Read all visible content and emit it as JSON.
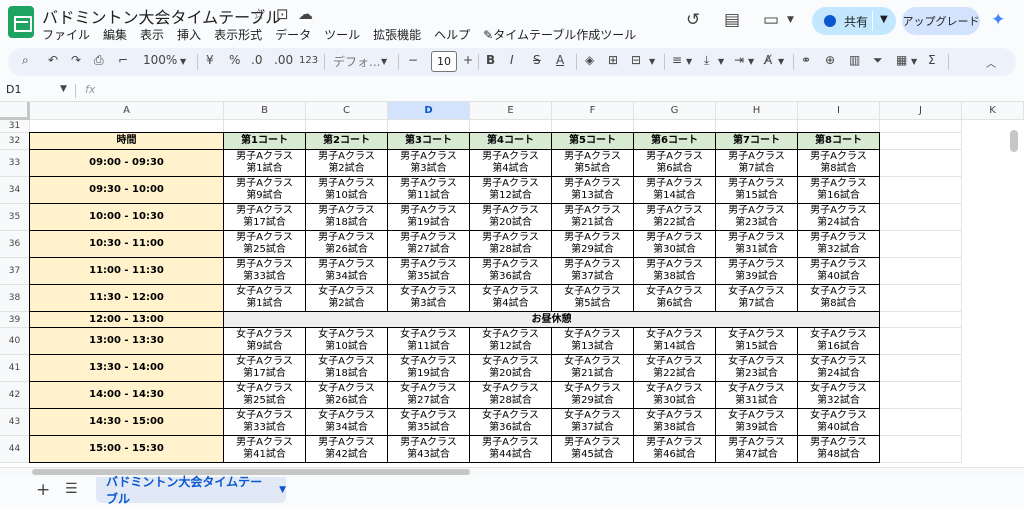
{
  "header": {
    "title": "バドミントン大会タイムテーブル",
    "menu": [
      "ファイル",
      "編集",
      "表示",
      "挿入",
      "表示形式",
      "データ",
      "ツール",
      "拡張機能",
      "ヘルプ",
      "タイムテーブル作成ツール"
    ],
    "share_label": "共有",
    "upgrade_label": "アップグレード"
  },
  "toolbar": {
    "zoom": "100%",
    "currency": "¥",
    "percent": "%",
    "dec_decrease": ".0",
    "dec_increase": ".00",
    "number_format": "123",
    "font": "デフォ...",
    "font_size": "10"
  },
  "formula_bar": {
    "cell_ref": "D1",
    "fx": "fx"
  },
  "columns": [
    "A",
    "B",
    "C",
    "D",
    "E",
    "F",
    "G",
    "H",
    "I",
    "J",
    "K"
  ],
  "selected_column": "D",
  "rows": [
    "31",
    "32",
    "33",
    "34",
    "35",
    "36",
    "37",
    "38",
    "39",
    "40",
    "41",
    "42",
    "43",
    "44"
  ],
  "table": {
    "time_header": "時間",
    "courts": [
      "第1コート",
      "第2コート",
      "第3コート",
      "第4コート",
      "第5コート",
      "第6コート",
      "第7コート",
      "第8コート"
    ],
    "break_label": "お昼休憩",
    "slots": [
      {
        "time": "09:00 - 09:30",
        "cells": [
          [
            "男子Aクラス",
            "第1試合"
          ],
          [
            "男子Aクラス",
            "第2試合"
          ],
          [
            "男子Aクラス",
            "第3試合"
          ],
          [
            "男子Aクラス",
            "第4試合"
          ],
          [
            "男子Aクラス",
            "第5試合"
          ],
          [
            "男子Aクラス",
            "第6試合"
          ],
          [
            "男子Aクラス",
            "第7試合"
          ],
          [
            "男子Aクラス",
            "第8試合"
          ]
        ]
      },
      {
        "time": "09:30 - 10:00",
        "cells": [
          [
            "男子Aクラス",
            "第9試合"
          ],
          [
            "男子Aクラス",
            "第10試合"
          ],
          [
            "男子Aクラス",
            "第11試合"
          ],
          [
            "男子Aクラス",
            "第12試合"
          ],
          [
            "男子Aクラス",
            "第13試合"
          ],
          [
            "男子Aクラス",
            "第14試合"
          ],
          [
            "男子Aクラス",
            "第15試合"
          ],
          [
            "男子Aクラス",
            "第16試合"
          ]
        ]
      },
      {
        "time": "10:00 - 10:30",
        "cells": [
          [
            "男子Aクラス",
            "第17試合"
          ],
          [
            "男子Aクラス",
            "第18試合"
          ],
          [
            "男子Aクラス",
            "第19試合"
          ],
          [
            "男子Aクラス",
            "第20試合"
          ],
          [
            "男子Aクラス",
            "第21試合"
          ],
          [
            "男子Aクラス",
            "第22試合"
          ],
          [
            "男子Aクラス",
            "第23試合"
          ],
          [
            "男子Aクラス",
            "第24試合"
          ]
        ]
      },
      {
        "time": "10:30 - 11:00",
        "cells": [
          [
            "男子Aクラス",
            "第25試合"
          ],
          [
            "男子Aクラス",
            "第26試合"
          ],
          [
            "男子Aクラス",
            "第27試合"
          ],
          [
            "男子Aクラス",
            "第28試合"
          ],
          [
            "男子Aクラス",
            "第29試合"
          ],
          [
            "男子Aクラス",
            "第30試合"
          ],
          [
            "男子Aクラス",
            "第31試合"
          ],
          [
            "男子Aクラス",
            "第32試合"
          ]
        ]
      },
      {
        "time": "11:00 - 11:30",
        "cells": [
          [
            "男子Aクラス",
            "第33試合"
          ],
          [
            "男子Aクラス",
            "第34試合"
          ],
          [
            "男子Aクラス",
            "第35試合"
          ],
          [
            "男子Aクラス",
            "第36試合"
          ],
          [
            "男子Aクラス",
            "第37試合"
          ],
          [
            "男子Aクラス",
            "第38試合"
          ],
          [
            "男子Aクラス",
            "第39試合"
          ],
          [
            "男子Aクラス",
            "第40試合"
          ]
        ]
      },
      {
        "time": "11:30 - 12:00",
        "cells": [
          [
            "女子Aクラス",
            "第1試合"
          ],
          [
            "女子Aクラス",
            "第2試合"
          ],
          [
            "女子Aクラス",
            "第3試合"
          ],
          [
            "女子Aクラス",
            "第4試合"
          ],
          [
            "女子Aクラス",
            "第5試合"
          ],
          [
            "女子Aクラス",
            "第6試合"
          ],
          [
            "女子Aクラス",
            "第7試合"
          ],
          [
            "女子Aクラス",
            "第8試合"
          ]
        ]
      },
      {
        "time": "12:00 - 13:00",
        "break": true
      },
      {
        "time": "13:00 - 13:30",
        "cells": [
          [
            "女子Aクラス",
            "第9試合"
          ],
          [
            "女子Aクラス",
            "第10試合"
          ],
          [
            "女子Aクラス",
            "第11試合"
          ],
          [
            "女子Aクラス",
            "第12試合"
          ],
          [
            "女子Aクラス",
            "第13試合"
          ],
          [
            "女子Aクラス",
            "第14試合"
          ],
          [
            "女子Aクラス",
            "第15試合"
          ],
          [
            "女子Aクラス",
            "第16試合"
          ]
        ]
      },
      {
        "time": "13:30 - 14:00",
        "cells": [
          [
            "女子Aクラス",
            "第17試合"
          ],
          [
            "女子Aクラス",
            "第18試合"
          ],
          [
            "女子Aクラス",
            "第19試合"
          ],
          [
            "女子Aクラス",
            "第20試合"
          ],
          [
            "女子Aクラス",
            "第21試合"
          ],
          [
            "女子Aクラス",
            "第22試合"
          ],
          [
            "女子Aクラス",
            "第23試合"
          ],
          [
            "女子Aクラス",
            "第24試合"
          ]
        ]
      },
      {
        "time": "14:00 - 14:30",
        "cells": [
          [
            "女子Aクラス",
            "第25試合"
          ],
          [
            "女子Aクラス",
            "第26試合"
          ],
          [
            "女子Aクラス",
            "第27試合"
          ],
          [
            "女子Aクラス",
            "第28試合"
          ],
          [
            "女子Aクラス",
            "第29試合"
          ],
          [
            "女子Aクラス",
            "第30試合"
          ],
          [
            "女子Aクラス",
            "第31試合"
          ],
          [
            "女子Aクラス",
            "第32試合"
          ]
        ]
      },
      {
        "time": "14:30 - 15:00",
        "cells": [
          [
            "女子Aクラス",
            "第33試合"
          ],
          [
            "女子Aクラス",
            "第34試合"
          ],
          [
            "女子Aクラス",
            "第35試合"
          ],
          [
            "女子Aクラス",
            "第36試合"
          ],
          [
            "女子Aクラス",
            "第37試合"
          ],
          [
            "女子Aクラス",
            "第38試合"
          ],
          [
            "女子Aクラス",
            "第39試合"
          ],
          [
            "女子Aクラス",
            "第40試合"
          ]
        ]
      },
      {
        "time": "15:00 - 15:30",
        "cells": [
          [
            "男子Aクラス",
            "第41試合"
          ],
          [
            "男子Aクラス",
            "第42試合"
          ],
          [
            "男子Aクラス",
            "第43試合"
          ],
          [
            "男子Aクラス",
            "第44試合"
          ],
          [
            "男子Aクラス",
            "第45試合"
          ],
          [
            "男子Aクラス",
            "第46試合"
          ],
          [
            "男子Aクラス",
            "第47試合"
          ],
          [
            "男子Aクラス",
            "第48試合"
          ]
        ]
      }
    ]
  },
  "sheet_tab": "バドミントン大会タイムテーブル",
  "colors": {
    "time_fill": "#fff2cc",
    "court_fill": "#d9ead3",
    "break_fill": "#efefef",
    "selected_header": "#d3e3fd",
    "brand_green": "#1ea362"
  }
}
